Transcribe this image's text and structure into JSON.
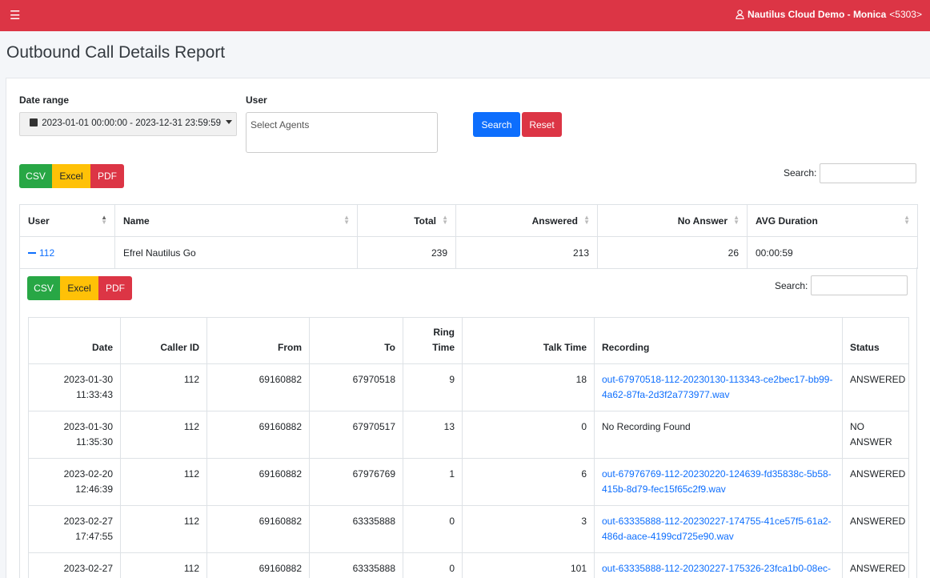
{
  "topbar": {
    "menu_icon": "hamburger-icon",
    "user_label": "Nautilus Cloud Demo - Monica",
    "extension": "<5303>"
  },
  "page": {
    "title": "Outbound Call Details Report"
  },
  "filters": {
    "date_range_label": "Date range",
    "date_range_value": "2023-01-01 00:00:00 - 2023-12-31 23:59:59",
    "user_label": "User",
    "user_placeholder": "Select Agents",
    "search_button": "Search",
    "reset_button": "Reset"
  },
  "export": {
    "csv": "CSV",
    "excel": "Excel",
    "pdf": "PDF"
  },
  "search": {
    "label": "Search:"
  },
  "summary": {
    "columns": [
      "User",
      "Name",
      "Total",
      "Answered",
      "No Answer",
      "AVG Duration"
    ],
    "row": {
      "user": "112",
      "name": "Efrel Nautilus Go",
      "total": "239",
      "answered": "213",
      "no_answer": "26",
      "avg_duration": "00:00:59"
    }
  },
  "detail": {
    "columns": [
      "Date",
      "Caller ID",
      "From",
      "To",
      "Ring Time",
      "Talk Time",
      "Recording",
      "Status"
    ],
    "rows": [
      {
        "date": "2023-01-30 11:33:43",
        "caller_id": "112",
        "from": "69160882",
        "to": "67970518",
        "ring": "9",
        "talk": "18",
        "recording": "out-67970518-112-20230130-113343-ce2bec17-bb99-4a62-87fa-2d3f2a773977.wav",
        "is_link": true,
        "status": "ANSWERED"
      },
      {
        "date": "2023-01-30 11:35:30",
        "caller_id": "112",
        "from": "69160882",
        "to": "67970517",
        "ring": "13",
        "talk": "0",
        "recording": "No Recording Found",
        "is_link": false,
        "status": "NO ANSWER"
      },
      {
        "date": "2023-02-20 12:46:39",
        "caller_id": "112",
        "from": "69160882",
        "to": "67976769",
        "ring": "1",
        "talk": "6",
        "recording": "out-67976769-112-20230220-124639-fd35838c-5b58-415b-8d79-fec15f65c2f9.wav",
        "is_link": true,
        "status": "ANSWERED"
      },
      {
        "date": "2023-02-27 17:47:55",
        "caller_id": "112",
        "from": "69160882",
        "to": "63335888",
        "ring": "0",
        "talk": "3",
        "recording": "out-63335888-112-20230227-174755-41ce57f5-61a2-486d-aace-4199cd725e90.wav",
        "is_link": true,
        "status": "ANSWERED"
      },
      {
        "date": "2023-02-27",
        "caller_id": "112",
        "from": "69160882",
        "to": "63335888",
        "ring": "0",
        "talk": "101",
        "recording": "out-63335888-112-20230227-175326-23fca1b0-08ec-",
        "is_link": true,
        "status": "ANSWERED"
      }
    ]
  }
}
